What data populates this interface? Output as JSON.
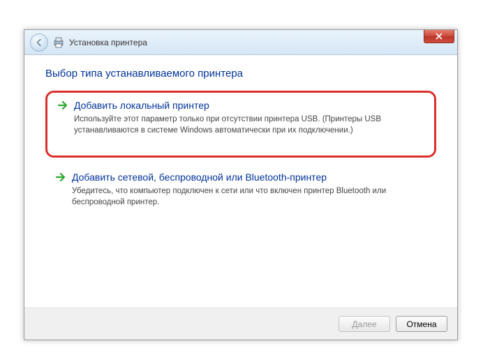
{
  "titlebar": {
    "title": "Установка принтера"
  },
  "content": {
    "heading": "Выбор типа устанавливаемого принтера",
    "options": [
      {
        "title": "Добавить локальный принтер",
        "description": "Используйте этот параметр только при отсутствии принтера USB. (Принтеры USB устанавливаются в системе Windows автоматически при их подключении.)"
      },
      {
        "title": "Добавить сетевой, беспроводной или Bluetooth-принтер",
        "description": "Убедитесь, что компьютер подключен к сети или что включен принтер Bluetooth или беспроводной принтер."
      }
    ]
  },
  "footer": {
    "next": "Далее",
    "cancel": "Отмена"
  }
}
